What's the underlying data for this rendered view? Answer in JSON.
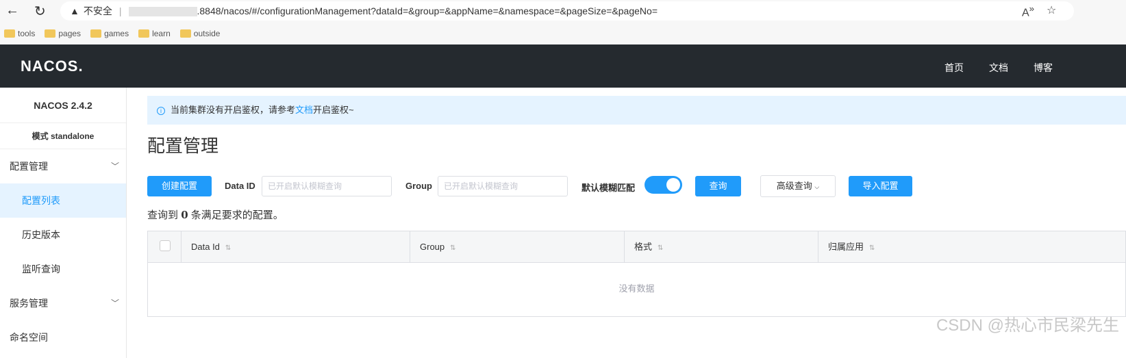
{
  "browser": {
    "back": "←",
    "reload": "↻",
    "security": "不安全",
    "url": ".8848/nacos/#/configurationManagement?dataId=&group=&appName=&namespace=&pageSize=&pageNo=",
    "bookmarks": [
      "tools",
      "pages",
      "games",
      "learn",
      "outside"
    ]
  },
  "header": {
    "logo": "NACOS.",
    "nav": [
      "首页",
      "文档",
      "博客"
    ]
  },
  "sidebar": {
    "version": "NACOS 2.4.2",
    "mode": "模式 standalone",
    "groups": [
      {
        "label": "配置管理",
        "items": [
          "配置列表",
          "历史版本",
          "监听查询"
        ]
      },
      {
        "label": "服务管理"
      }
    ],
    "namespace": "命名空间"
  },
  "alert": {
    "prefix": "当前集群没有开启鉴权，请参考",
    "link": "文档",
    "suffix": "开启鉴权~"
  },
  "page_title": "配置管理",
  "toolbar": {
    "create": "创建配置",
    "data_id_label": "Data ID",
    "placeholder": "已开启默认模糊查询",
    "group_label": "Group",
    "fuzzy_label": "默认模糊匹配",
    "fuzzy_on": true,
    "query": "查询",
    "advanced": "高级查询",
    "import": "导入配置"
  },
  "result": {
    "prefix": "查询到",
    "count": "0",
    "suffix": "条满足要求的配置。"
  },
  "table": {
    "columns": [
      "Data Id",
      "Group",
      "格式",
      "归属应用"
    ],
    "empty": "没有数据"
  },
  "watermark": "CSDN @热心市民梁先生"
}
